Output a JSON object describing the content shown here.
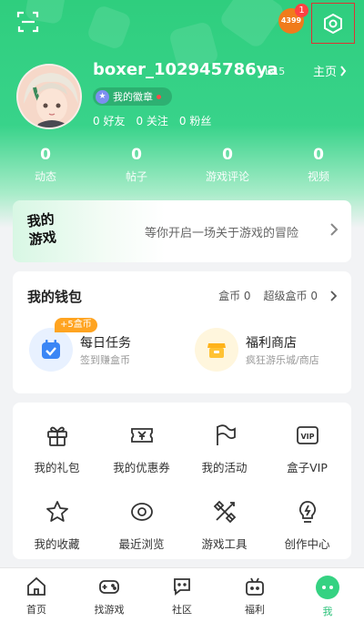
{
  "header": {
    "badge_text": "4399",
    "notification_count": "1"
  },
  "profile": {
    "username": "boxer_102945786ya",
    "level": "Lv.5",
    "homepage_label": "主页",
    "medal_label": "我的徽章",
    "friends": "0 好友",
    "follows": "0 关注",
    "fans": "0 粉丝"
  },
  "stats": [
    {
      "value": "0",
      "label": "动态"
    },
    {
      "value": "0",
      "label": "帖子"
    },
    {
      "value": "0",
      "label": "游戏评论"
    },
    {
      "value": "0",
      "label": "视频"
    }
  ],
  "adventure": {
    "logo_line1": "我的",
    "logo_line2": "游戏",
    "text": "等你开启一场关于游戏的冒险"
  },
  "wallet": {
    "title": "我的钱包",
    "box_coins": "盒币 0",
    "super_coins": "超级盒币 0",
    "task_title": "每日任务",
    "task_sub": "签到赚盒币",
    "task_tag": "+5盒币",
    "shop_title": "福利商店",
    "shop_sub": "疯狂游乐城/商店"
  },
  "features": [
    {
      "label": "我的礼包",
      "icon": "gift-icon"
    },
    {
      "label": "我的优惠券",
      "icon": "coupon-icon"
    },
    {
      "label": "我的活动",
      "icon": "flag-icon"
    },
    {
      "label": "盒子VIP",
      "icon": "vip-icon"
    },
    {
      "label": "我的收藏",
      "icon": "star-icon"
    },
    {
      "label": "最近浏览",
      "icon": "eye-icon"
    },
    {
      "label": "游戏工具",
      "icon": "tools-icon"
    },
    {
      "label": "创作中心",
      "icon": "creator-icon"
    }
  ],
  "nav": [
    {
      "label": "首页",
      "icon": "home-icon"
    },
    {
      "label": "找游戏",
      "icon": "gamepad-icon"
    },
    {
      "label": "社区",
      "icon": "chat-icon"
    },
    {
      "label": "福利",
      "icon": "gift-box-icon"
    },
    {
      "label": "我",
      "icon": "me-icon",
      "active": true
    }
  ],
  "colors": {
    "brand_green": "#2fce7e",
    "active_nav": "#2cc27a",
    "badge_orange": "#f07b1c",
    "coin_tag": "#ffa421"
  }
}
